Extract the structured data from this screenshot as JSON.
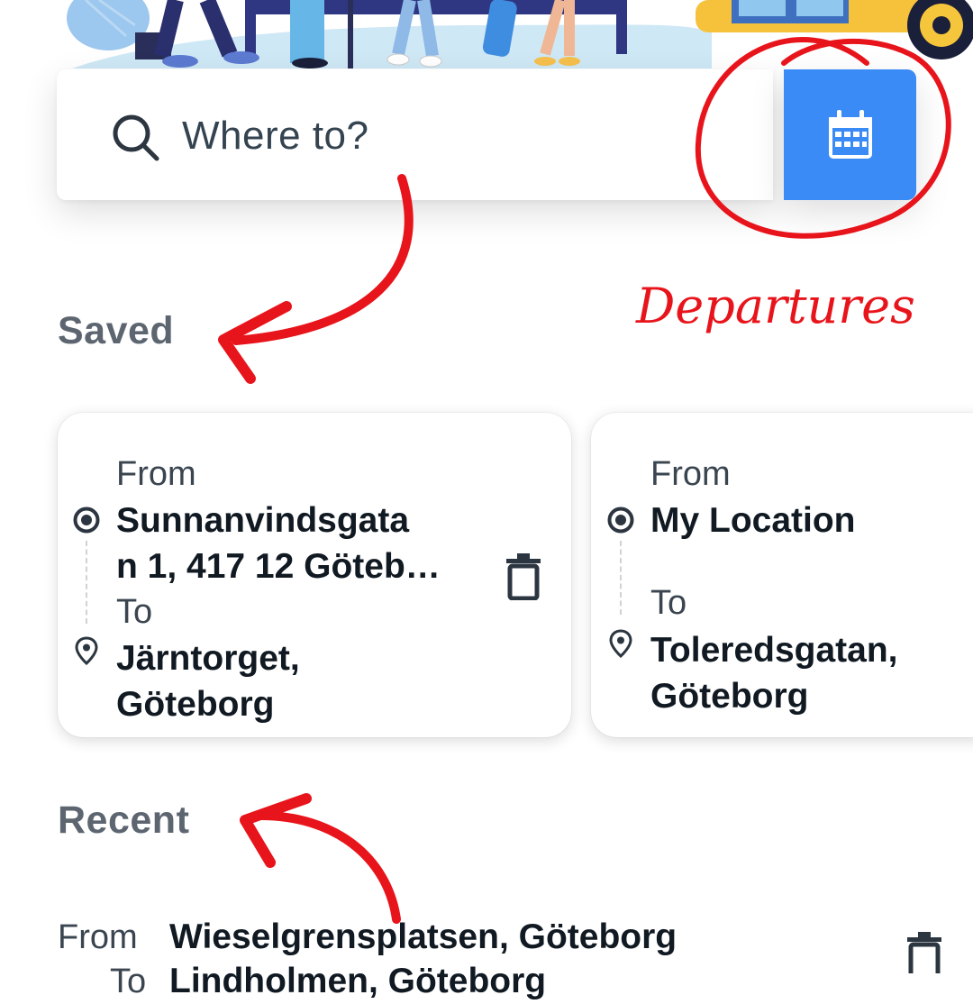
{
  "search": {
    "placeholder": "Where to?"
  },
  "annotation": {
    "departures_label": "Departures"
  },
  "saved": {
    "title": "Saved",
    "cards": [
      {
        "from_label": "From",
        "from_line1": "Sunnanvindsgata",
        "from_line2": "n 1, 417 12 Göteb…",
        "to_label": "To",
        "to_line1": "Järntorget,",
        "to_line2": "Göteborg"
      },
      {
        "from_label": "From",
        "from_line1": "My Location",
        "to_label": "To",
        "to_line1": "Toleredsgatan,",
        "to_line2": "Göteborg"
      }
    ]
  },
  "recent": {
    "title": "Recent",
    "items": [
      {
        "from_label": "From",
        "from_value": "Wieselgrensplatsen, Göteborg",
        "to_label": "To",
        "to_value": "Lindholmen, Göteborg"
      }
    ]
  },
  "colors": {
    "accent": "#3b8bf6",
    "annotation": "#e8141b"
  },
  "icons": [
    "search-icon",
    "calendar-icon",
    "origin-target-icon",
    "destination-pin-icon",
    "trash-icon"
  ]
}
